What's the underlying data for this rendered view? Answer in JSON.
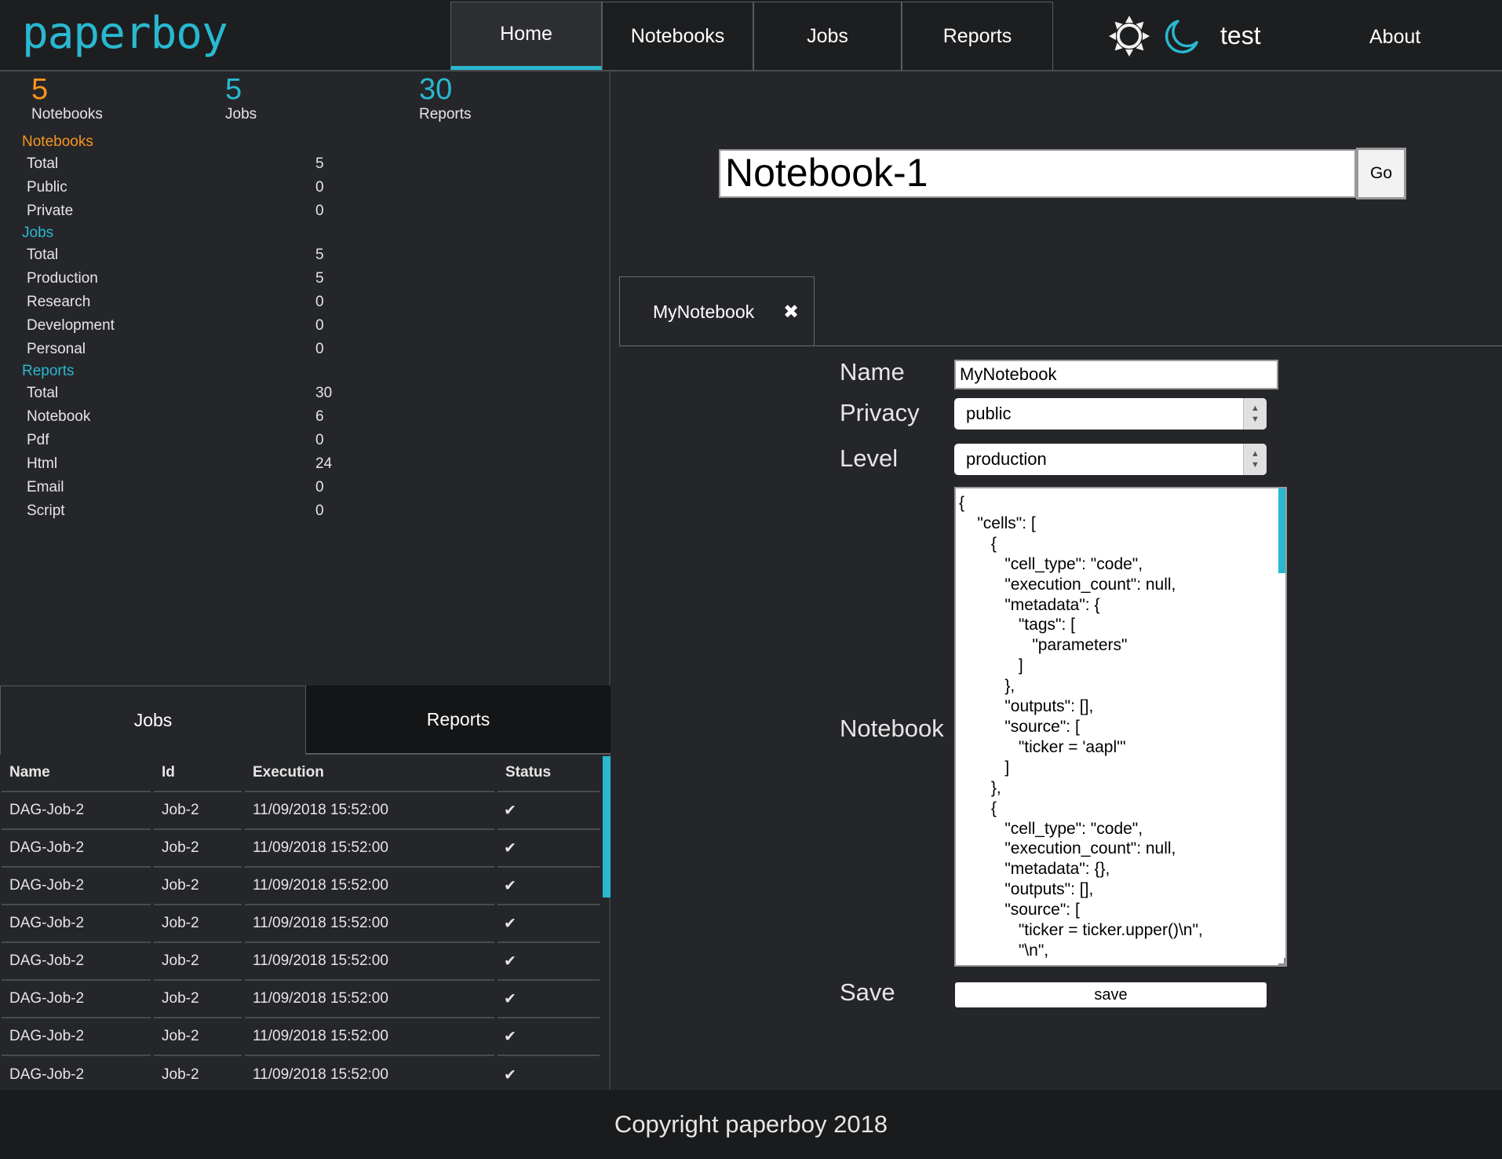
{
  "app": {
    "logo": "paperboy"
  },
  "nav": {
    "tabs": [
      {
        "label": "Home",
        "active": true
      },
      {
        "label": "Notebooks"
      },
      {
        "label": "Jobs"
      },
      {
        "label": "Reports"
      }
    ],
    "user": "test",
    "about": "About",
    "icons": [
      "sun-icon",
      "moon-icon"
    ]
  },
  "summary": {
    "notebooks": {
      "count": "5",
      "label": "Notebooks",
      "color": "#f7941d"
    },
    "jobs": {
      "count": "5",
      "label": "Jobs",
      "color": "#29b8d0"
    },
    "reports": {
      "count": "30",
      "label": "Reports",
      "color": "#29b8d0"
    }
  },
  "stats": {
    "notebooks": {
      "title": "Notebooks",
      "rows": [
        {
          "label": "Total",
          "value": "5"
        },
        {
          "label": "Public",
          "value": "0"
        },
        {
          "label": "Private",
          "value": "0"
        }
      ]
    },
    "jobs": {
      "title": "Jobs",
      "rows": [
        {
          "label": "Total",
          "value": "5"
        },
        {
          "label": "Production",
          "value": "5"
        },
        {
          "label": "Research",
          "value": "0"
        },
        {
          "label": "Development",
          "value": "0"
        },
        {
          "label": "Personal",
          "value": "0"
        }
      ]
    },
    "reports": {
      "title": "Reports",
      "rows": [
        {
          "label": "Total",
          "value": "30"
        },
        {
          "label": "Notebook",
          "value": "6"
        },
        {
          "label": "Pdf",
          "value": "0"
        },
        {
          "label": "Html",
          "value": "24"
        },
        {
          "label": "Email",
          "value": "0"
        },
        {
          "label": "Script",
          "value": "0"
        }
      ]
    }
  },
  "bottom_tabs": {
    "jobs": "Jobs",
    "reports": "Reports"
  },
  "jobs_table": {
    "headers": [
      "Name",
      "Id",
      "Execution",
      "Status"
    ],
    "rows": [
      [
        "DAG-Job-2",
        "Job-2",
        "11/09/2018 15:52:00",
        "✔"
      ],
      [
        "DAG-Job-2",
        "Job-2",
        "11/09/2018 15:52:00",
        "✔"
      ],
      [
        "DAG-Job-2",
        "Job-2",
        "11/09/2018 15:52:00",
        "✔"
      ],
      [
        "DAG-Job-2",
        "Job-2",
        "11/09/2018 15:52:00",
        "✔"
      ],
      [
        "DAG-Job-2",
        "Job-2",
        "11/09/2018 15:52:00",
        "✔"
      ],
      [
        "DAG-Job-2",
        "Job-2",
        "11/09/2018 15:52:00",
        "✔"
      ],
      [
        "DAG-Job-2",
        "Job-2",
        "11/09/2018 15:52:00",
        "✔"
      ],
      [
        "DAG-Job-2",
        "Job-2",
        "11/09/2018 15:52:00",
        "✔"
      ]
    ]
  },
  "search": {
    "value": "Notebook-1",
    "go_label": "Go"
  },
  "detail_tab": {
    "label": "MyNotebook",
    "close": "✖"
  },
  "form": {
    "name_label": "Name",
    "name_value": "MyNotebook",
    "privacy_label": "Privacy",
    "privacy_value": "public",
    "level_label": "Level",
    "level_value": "production",
    "notebook_label": "Notebook",
    "notebook_json": "{\n    \"cells\": [\n       {\n          \"cell_type\": \"code\",\n          \"execution_count\": null,\n          \"metadata\": {\n             \"tags\": [\n                \"parameters\"\n             ]\n          },\n          \"outputs\": [],\n          \"source\": [\n             \"ticker = 'aapl'\"\n          ]\n       },\n       {\n          \"cell_type\": \"code\",\n          \"execution_count\": null,\n          \"metadata\": {},\n          \"outputs\": [],\n          \"source\": [\n             \"ticker = ticker.upper()\\n\",\n             \"\\n\",",
    "save_label": "Save",
    "save_button": "save"
  },
  "footer": "Copyright paperboy 2018"
}
